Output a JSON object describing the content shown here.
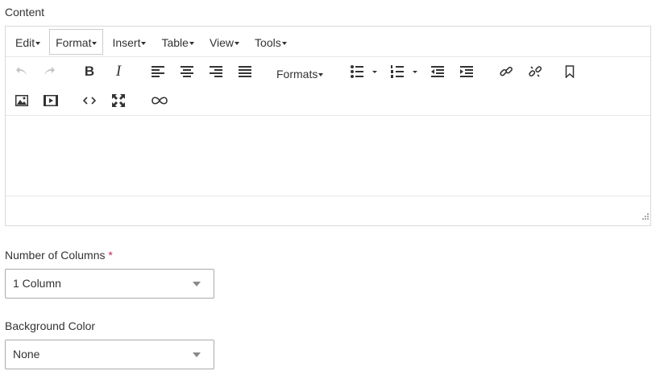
{
  "content_label": "Content",
  "menubar": [
    {
      "label": "Edit"
    },
    {
      "label": "Format"
    },
    {
      "label": "Insert"
    },
    {
      "label": "Table"
    },
    {
      "label": "View"
    },
    {
      "label": "Tools"
    }
  ],
  "toolbar": {
    "formats_label": "Formats",
    "icons": [
      "undo-icon",
      "redo-icon",
      "bold-icon",
      "italic-icon",
      "align-left-icon",
      "align-center-icon",
      "align-right-icon",
      "align-justify-icon",
      "bullet-list-icon",
      "numbered-list-icon",
      "outdent-icon",
      "indent-icon",
      "link-icon",
      "unlink-icon",
      "bookmark-icon",
      "image-icon",
      "media-icon",
      "source-code-icon",
      "fullscreen-icon",
      "embed-link-icon"
    ]
  },
  "columns_field": {
    "label": "Number of Columns",
    "required_mark": "*",
    "value": "1 Column"
  },
  "background_field": {
    "label": "Background Color",
    "value": "None"
  }
}
